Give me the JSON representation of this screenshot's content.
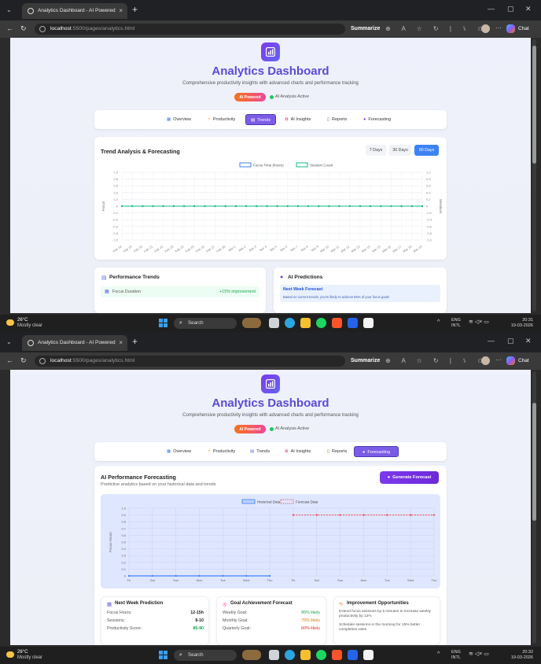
{
  "browser": {
    "tab_title": "Analytics Dashboard - AI Powered",
    "url_host": "localhost",
    "url_path": ":5500/pages/analytics.html",
    "summarize_label": "Summarize",
    "chat_label": "Chat"
  },
  "header": {
    "title": "Analytics Dashboard",
    "subtitle": "Comprehensive productivity insights with advanced charts and performance tracking",
    "ai_badge": "AI Powered",
    "ai_status": "AI Analysis Active"
  },
  "nav_tabs": [
    {
      "label": "Overview",
      "icon": "chart-icon"
    },
    {
      "label": "Productivity",
      "icon": "bolt-icon"
    },
    {
      "label": "Trends",
      "icon": "trend-icon"
    },
    {
      "label": "AI Insights",
      "icon": "brain-icon"
    },
    {
      "label": "Reports",
      "icon": "clipboard-icon"
    },
    {
      "label": "Forecasting",
      "icon": "crystal-ball-icon"
    }
  ],
  "view1": {
    "active_tab": "Trends",
    "trend_card": {
      "title": "Trend Analysis & Forecasting",
      "ranges": [
        "7 Days",
        "30 Days",
        "90 Days"
      ],
      "active_range": "90 Days"
    },
    "performance": {
      "title": "Performance Trends",
      "row_label": "Focus Duration",
      "row_value": "+15% improvement"
    },
    "predictions": {
      "title": "AI Predictions",
      "item_title": "Next Week Forecast",
      "item_text": "Based on current trends, you're likely to achieve 85% of your focus goals"
    }
  },
  "view2": {
    "active_tab": "Forecasting",
    "forecast_card": {
      "title": "AI Performance Forecasting",
      "subtitle": "Predictive analytics based on your historical data and trends",
      "button": "Generate Forecast"
    },
    "next_week": {
      "title": "Next Week Prediction",
      "rows": [
        {
          "label": "Focus Hours:",
          "value": "12-15h"
        },
        {
          "label": "Sessions:",
          "value": "8-10"
        },
        {
          "label": "Productivity Score:",
          "value": "85-90"
        }
      ]
    },
    "goals": {
      "title": "Goal Achievement Forecast",
      "rows": [
        {
          "label": "Weekly Goal:",
          "value": "85% likely"
        },
        {
          "label": "Monthly Goal:",
          "value": "75% likely"
        },
        {
          "label": "Quarterly Goal:",
          "value": "60% likely"
        }
      ]
    },
    "improvements": {
      "title": "Improvement Opportunities",
      "items": [
        "Extend focus sessions by 5 minutes to increase weekly productivity by 12%",
        "Schedule sessions in the morning for 15% better completion rates"
      ]
    }
  },
  "chart_data": [
    {
      "type": "line",
      "title": "",
      "series": [
        {
          "name": "Focus Time (hours)",
          "color": "#3b82f6",
          "values": [
            0,
            0,
            0,
            0,
            0,
            0,
            0,
            0,
            0,
            0,
            0,
            0,
            0,
            0,
            0,
            0,
            0,
            0,
            0,
            0,
            0,
            0,
            0,
            0,
            0,
            0,
            0,
            0,
            0,
            0
          ]
        },
        {
          "name": "Session Count",
          "color": "#10b981",
          "values": [
            0,
            0,
            0,
            0,
            0,
            0,
            0,
            0,
            0,
            0,
            0,
            0,
            0,
            0,
            0,
            0,
            0,
            0,
            0,
            0,
            0,
            0,
            0,
            0,
            0,
            0,
            0,
            0,
            0,
            0
          ]
        }
      ],
      "categories": [
        "Feb 18",
        "Feb 19",
        "Feb 20",
        "Feb 21",
        "Feb 22",
        "Feb 23",
        "Feb 24",
        "Feb 25",
        "Feb 26",
        "Feb 27",
        "Feb 28",
        "Mar 1",
        "Mar 2",
        "Mar 3",
        "Mar 4",
        "Mar 5",
        "Mar 6",
        "Mar 7",
        "Mar 8",
        "Mar 9",
        "Mar 10",
        "Mar 11",
        "Mar 12",
        "Mar 13",
        "Mar 14",
        "Mar 15",
        "Mar 16",
        "Mar 17",
        "Mar 18",
        "Mar 19"
      ],
      "ylabel": "Focus",
      "y2label": "Sessions",
      "ylim": [
        -1.0,
        1.0
      ],
      "yticks": [
        "1.0",
        "0.8",
        "0.6",
        "0.4",
        "0.2",
        "0",
        "-0.2",
        "-0.4",
        "-0.6",
        "-0.8",
        "-1.0"
      ],
      "grid": true,
      "legend": "top-center"
    },
    {
      "type": "line",
      "title": "",
      "categories": [
        "Fri",
        "Sat",
        "Sun",
        "Mon",
        "Tue",
        "Wed",
        "Thu",
        "Fri",
        "Sat",
        "Sun",
        "Mon",
        "Tue",
        "Wed",
        "Thu"
      ],
      "series": [
        {
          "name": "Historical Data",
          "color": "#3b82f6",
          "values": [
            0,
            0,
            0,
            0,
            0,
            0,
            0,
            null,
            null,
            null,
            null,
            null,
            null,
            null
          ]
        },
        {
          "name": "Forecast Data",
          "color": "#ef4444",
          "values": [
            null,
            null,
            null,
            null,
            null,
            null,
            null,
            0.9,
            0.9,
            0.9,
            0.9,
            0.9,
            0.9,
            0.9
          ]
        }
      ],
      "ylabel": "Focus Hours",
      "ylim": [
        0,
        1.0
      ],
      "yticks": [
        "1.0",
        "0.9",
        "0.8",
        "0.7",
        "0.6",
        "0.5",
        "0.4",
        "0.3",
        "0.2",
        "0.1",
        "0"
      ],
      "grid": true,
      "legend": "top-center"
    }
  ],
  "taskbar": {
    "temp": "26°C",
    "weather": "Mostly clear",
    "search": "Search",
    "lang1": "ENG",
    "lang2": "INTL",
    "time1": "20:31",
    "time2": "20:32",
    "date": "19-03-2026"
  }
}
